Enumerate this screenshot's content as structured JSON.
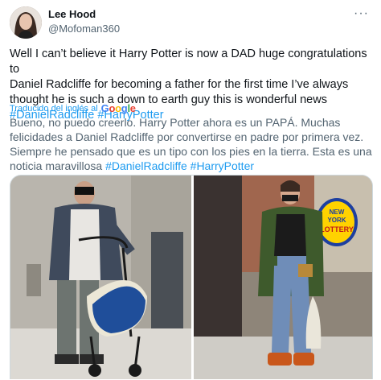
{
  "user": {
    "name": "Lee Hood",
    "handle": "@Mofoman360"
  },
  "more_icon": "more-horizontal-icon",
  "tweet": {
    "text_line1": "Well I can’t believe it Harry Potter is now a DAD huge congratulations to",
    "text_line2": "Daniel Radcliffe for becoming a father for the first time I’ve always",
    "text_line3": "thought he is such a down to earth guy this is wonderful news",
    "hashtag1": "#DanielRadcliffe",
    "hashtag2": "#HarryPotter"
  },
  "translation": {
    "label": "Traducido del inglés al",
    "provider": "Google",
    "line1": "Bueno, no puedo creerlo. Harry Potter ahora es un PAPÁ. Muchas",
    "line2": "felicidades a Daniel Radcliffe por convertirse en padre por primera vez.",
    "line3": "Siempre he pensado que es un tipo con los pies en la tierra. Esta es una",
    "line4_text": "noticia maravillosa",
    "hashtag1": "#DanielRadcliffe",
    "hashtag2": "#HarryPotter"
  },
  "photo_right": {
    "sign_line1": "NEW",
    "sign_line2": "YORK",
    "sign_line3": "LOTTERY"
  }
}
